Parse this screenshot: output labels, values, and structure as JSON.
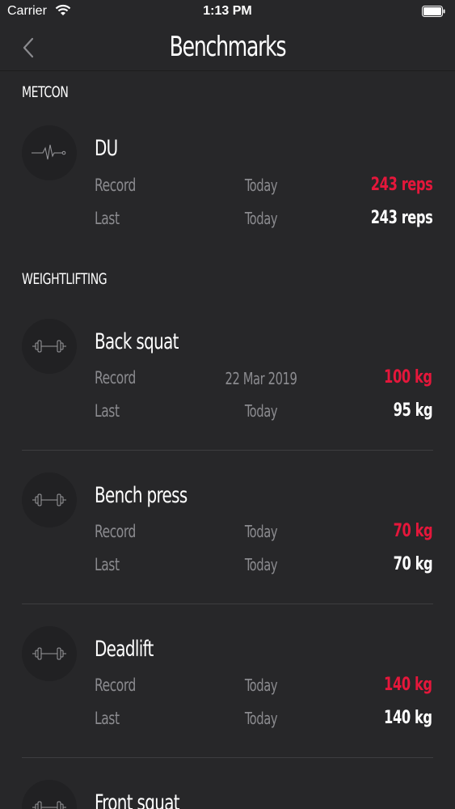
{
  "status_bar": {
    "carrier": "Carrier",
    "time": "1:13 PM"
  },
  "nav": {
    "title": "Benchmarks"
  },
  "sections": {
    "metcon": {
      "title": "METCON"
    },
    "weightlifting": {
      "title": "WEIGHTLIFTING"
    }
  },
  "items": [
    {
      "name": "DU",
      "icon": "heartbeat-icon",
      "record_label": "Record",
      "record_date": "Today",
      "record_value": "243 reps",
      "last_label": "Last",
      "last_date": "Today",
      "last_value": "243 reps"
    },
    {
      "name": "Back squat",
      "icon": "dumbbell-icon",
      "record_label": "Record",
      "record_date": "22 Mar 2019",
      "record_value": "100 kg",
      "last_label": "Last",
      "last_date": "Today",
      "last_value": "95 kg"
    },
    {
      "name": "Bench press",
      "icon": "dumbbell-icon",
      "record_label": "Record",
      "record_date": "Today",
      "record_value": "70 kg",
      "last_label": "Last",
      "last_date": "Today",
      "last_value": "70 kg"
    },
    {
      "name": "Deadlift",
      "icon": "dumbbell-icon",
      "record_label": "Record",
      "record_date": "Today",
      "record_value": "140 kg",
      "last_label": "Last",
      "last_date": "Today",
      "last_value": "140 kg"
    },
    {
      "name": "Front squat",
      "icon": "dumbbell-icon"
    }
  ],
  "colors": {
    "background": "#272729",
    "record": "#e5173b",
    "label": "#8b8b8f"
  }
}
